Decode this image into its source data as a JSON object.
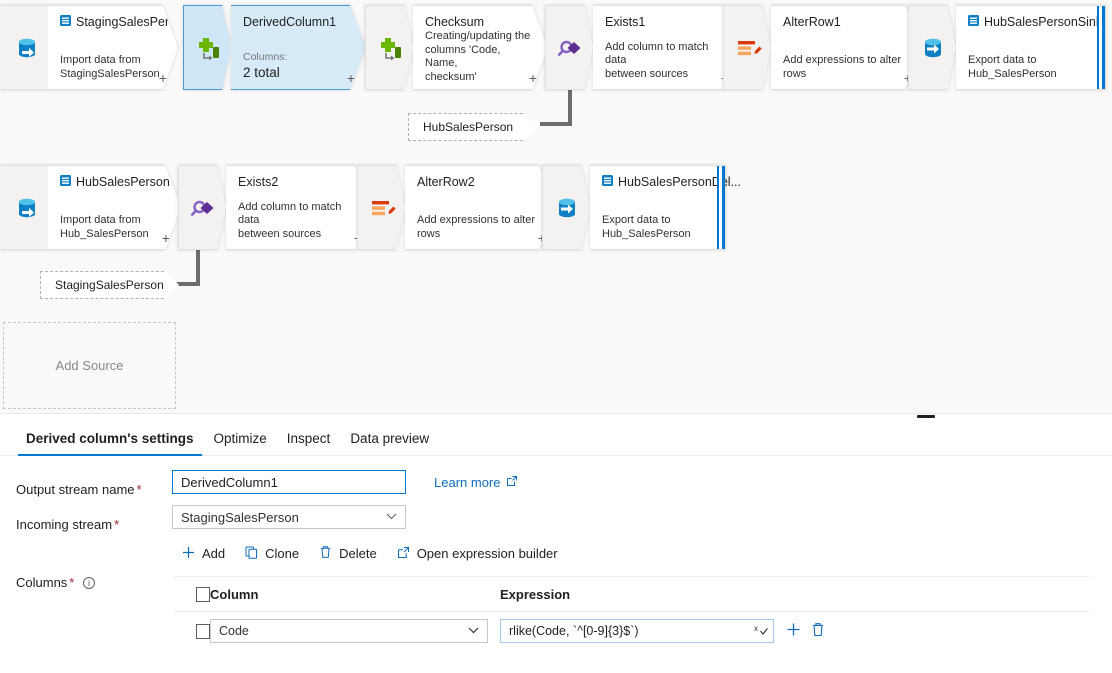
{
  "canvas": {
    "nodes": [
      {
        "id": "staging-source",
        "name": "StagingSalesPerson",
        "desc": "Import data from\nStagingSalesPerson",
        "icon": "source-db-icon",
        "kind": "source",
        "badge": "sql-table-icon"
      },
      {
        "id": "derived-column-1",
        "name": "DerivedColumn1",
        "columns_label": "Columns:",
        "columns_value": "2 total",
        "icon": "derived-column-icon",
        "kind": "derivedColumn",
        "selected": true
      },
      {
        "id": "checksum",
        "name": "Checksum",
        "desc": "Creating/updating the\ncolumns 'Code, Name,\nchecksum'",
        "icon": "derived-column-icon",
        "kind": "derivedColumn"
      },
      {
        "id": "exists-1",
        "name": "Exists1",
        "desc": "Add column to match data\nbetween sources",
        "icon": "exists-icon",
        "kind": "exists"
      },
      {
        "id": "alter-row-1",
        "name": "AlterRow1",
        "desc": "Add expressions to alter rows",
        "icon": "alter-row-icon",
        "kind": "alterRow"
      },
      {
        "id": "hub-sales-person-sink",
        "name": "HubSalesPersonSink",
        "desc": "Export data to\nHub_SalesPerson",
        "icon": "sink-db-icon",
        "kind": "sink",
        "badge": "sql-table-icon"
      },
      {
        "id": "hub-source",
        "name": "HubSalesPerson",
        "desc": "Import data from\nHub_SalesPerson",
        "icon": "source-db-icon",
        "kind": "source",
        "badge": "sql-table-icon"
      },
      {
        "id": "exists-2",
        "name": "Exists2",
        "desc": "Add column to match data\nbetween sources",
        "icon": "exists-icon",
        "kind": "exists"
      },
      {
        "id": "alter-row-2",
        "name": "AlterRow2",
        "desc": "Add expressions to alter rows",
        "icon": "alter-row-icon",
        "kind": "alterRow"
      },
      {
        "id": "hub-sales-person-del-sink",
        "name": "HubSalesPersonDel...",
        "desc": "Export data to\nHub_SalesPerson",
        "icon": "sink-db-icon",
        "kind": "sink",
        "badge": "sql-table-icon"
      }
    ],
    "reference_chips": [
      {
        "id": "ref-hub-sales-person",
        "label": "HubSalesPerson"
      },
      {
        "id": "ref-staging-sales-person",
        "label": "StagingSalesPerson"
      }
    ],
    "add_source": {
      "label": "Add Source"
    },
    "plus_glyph": "+"
  },
  "panel": {
    "tabs": [
      {
        "id": "tab-derived-columns-settings",
        "label": "Derived column's settings",
        "active": true
      },
      {
        "id": "tab-optimize",
        "label": "Optimize",
        "active": false
      },
      {
        "id": "tab-inspect",
        "label": "Inspect",
        "active": false
      },
      {
        "id": "tab-data-preview",
        "label": "Data preview",
        "active": false
      }
    ],
    "output_stream": {
      "label": "Output stream name",
      "required_mark": "*",
      "value": "DerivedColumn1"
    },
    "incoming_stream": {
      "label": "Incoming stream",
      "required_mark": "*",
      "value": "StagingSalesPerson"
    },
    "learn_more": {
      "label": "Learn more",
      "icon": "external-link-icon"
    },
    "columns_label": {
      "label": "Columns",
      "required_mark": "*",
      "info_glyph": "i"
    },
    "commands": [
      {
        "id": "cmd-add",
        "label": "Add",
        "glyph": "+",
        "icon": "plus-icon"
      },
      {
        "id": "cmd-clone",
        "label": "Clone",
        "glyph": "❐",
        "icon": "copy-icon"
      },
      {
        "id": "cmd-delete",
        "label": "Delete",
        "glyph": "🗑",
        "icon": "trash-icon"
      },
      {
        "id": "cmd-open-expression-builder",
        "label": "Open expression builder",
        "glyph": "↗",
        "icon": "external-link-icon"
      }
    ],
    "table": {
      "headers": {
        "column": "Column",
        "expression": "Expression"
      },
      "rows": [
        {
          "column": "Code",
          "expression": "rlike(Code, `^[0-9]{3}$`)"
        }
      ],
      "row_actions": {
        "add_glyph": "+",
        "delete_glyph": "🗑"
      }
    }
  },
  "colors": {
    "accent": "#0078d4",
    "link": "#0f6cbd",
    "selected_node": "#d6eaf8",
    "required": "#a4262c",
    "canvas_bg": "#faf9f8"
  }
}
